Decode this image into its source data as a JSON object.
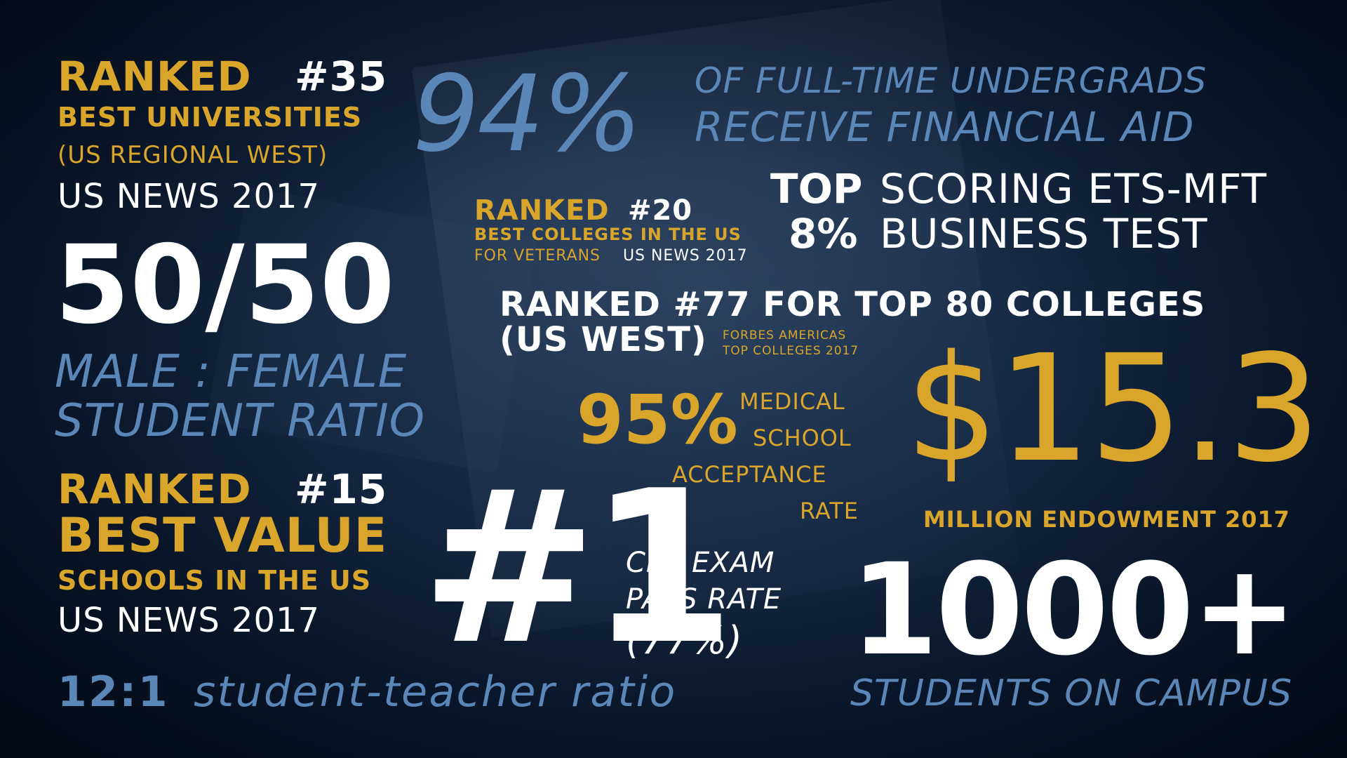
{
  "stats": {
    "rank35": {
      "ranked": "RANKED",
      "number": "#35",
      "line1": "BEST UNIVERSITIES",
      "line2": "(US REGIONAL WEST)",
      "source": "US NEWS 2017"
    },
    "aid": {
      "percent": "94%",
      "line1": "OF FULL-TIME UNDERGRADS",
      "line2": "RECEIVE FINANCIAL AID"
    },
    "rank20": {
      "ranked": "RANKED",
      "number": "#20",
      "line1": "BEST COLLEGES IN THE US",
      "line2": "FOR VETERANS",
      "source": "US NEWS 2017"
    },
    "ets": {
      "top": "TOP",
      "percent": "8%",
      "line1": "SCORING ETS-MFT",
      "line2": "BUSINESS TEST"
    },
    "ratio": {
      "value": "50/50",
      "line1": "MALE : FEMALE",
      "line2": "STUDENT RATIO"
    },
    "rank77": {
      "line1": "RANKED #77 FOR TOP 80 COLLEGES",
      "line2": "(US WEST)",
      "source1": "FORBES AMERICAS",
      "source2": "TOP COLLEGES 2017"
    },
    "medical": {
      "percent": "95%",
      "line1": "MEDICAL",
      "line2": "SCHOOL",
      "line3": "ACCEPTANCE",
      "line4": "RATE"
    },
    "endowment": {
      "value": "$15.3",
      "label": "MILLION ENDOWMENT 2017"
    },
    "rank15": {
      "ranked": "RANKED",
      "number": "#15",
      "line1": "BEST VALUE",
      "line2": "SCHOOLS IN THE US",
      "source": "US NEWS 2017"
    },
    "cpa": {
      "value": "#1",
      "line1": "CPA EXAM",
      "line2": "PASS RATE",
      "line3": "(77%)"
    },
    "students": {
      "value": "1000+",
      "label": "STUDENTS ON CAMPUS"
    },
    "teacher": {
      "value": "12:1",
      "label": "student-teacher ratio"
    }
  },
  "colors": {
    "gold": "#d9a52b",
    "blue": "#5b87b8",
    "white": "#ffffff",
    "background": "#0f2039"
  }
}
